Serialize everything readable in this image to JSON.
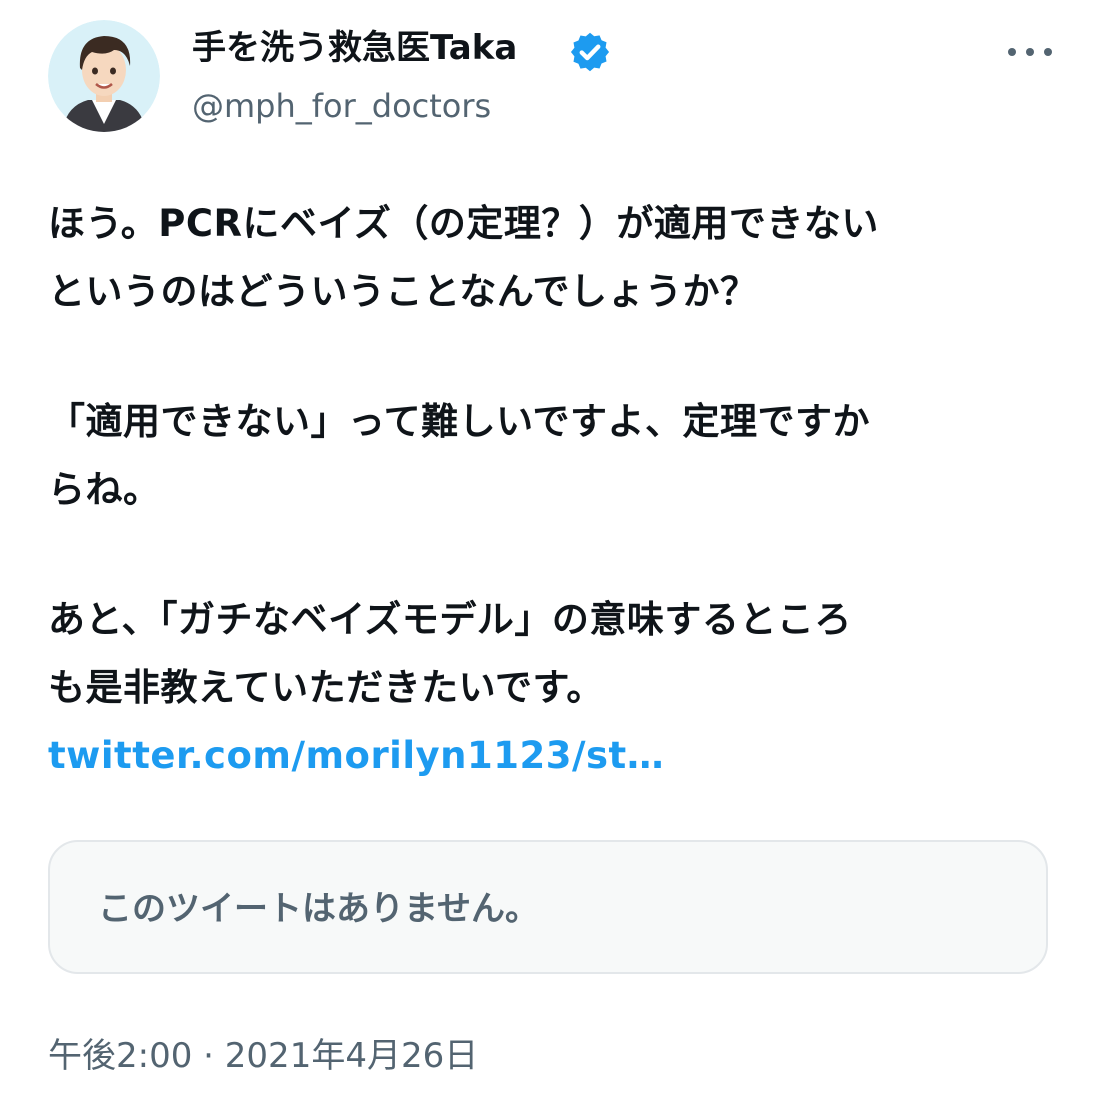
{
  "author": {
    "display_name": "手を洗う救急医Taka",
    "handle": "@mph_for_doctors",
    "verified": true
  },
  "tweet": {
    "paragraphs": [
      [
        "ほう。PCRにベイズ（の定理？）が適用できない",
        "というのはどういうことなんでしょうか？"
      ],
      [
        "「適用できない」って難しいですよ、定理ですか",
        "らね。"
      ],
      [
        "あと、「ガチなベイズモデル」の意味するところ",
        "も是非教えていただきたいです。"
      ]
    ],
    "link_text": "twitter.com/morilyn1123/st…"
  },
  "quoted_tweet": {
    "unavailable_text": "このツイートはありません。"
  },
  "meta": {
    "time": "午後2:00",
    "separator": "·",
    "date": "2021年4月26日"
  },
  "colors": {
    "text": "#0f1419",
    "secondary": "#536471",
    "link": "#1d9bf0",
    "verified_badge": "#1d9bf0",
    "quote_background": "#f7f9f9",
    "quote_border": "#e3e7ea"
  },
  "icons": {
    "avatar": "avatar-illustration",
    "verified": "verified-badge-icon",
    "more": "more-options-icon"
  }
}
